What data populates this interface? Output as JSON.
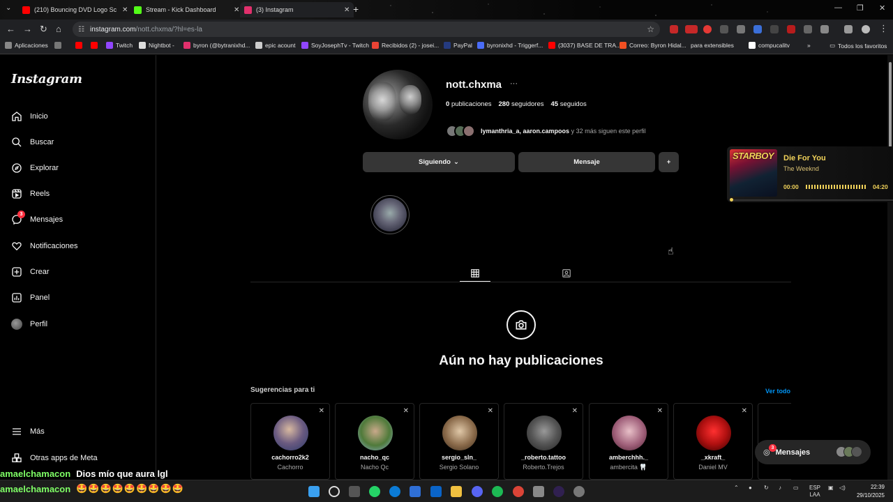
{
  "browser": {
    "tabs": [
      {
        "title": "(210) Bouncing DVD Logo Scre",
        "favicon_color": "#ff0000"
      },
      {
        "title": "Stream - Kick Dashboard",
        "favicon_color": "#53fc18"
      },
      {
        "title": "(3) Instagram",
        "favicon_color": "#e1306c"
      }
    ],
    "new_tab": "+",
    "url_host": "instagram.com",
    "url_path": "/nott.chxma/?hl=es-la",
    "bookmarks": [
      {
        "label": "Aplicaciones",
        "color": "#888888"
      },
      {
        "label": "",
        "color": "#ff0000"
      },
      {
        "label": "",
        "color": "#ff0000"
      },
      {
        "label": "Twitch",
        "color": "#9146ff"
      },
      {
        "label": "Nightbot -",
        "color": "#dddddd"
      },
      {
        "label": "byron (@bytranixhd...",
        "color": "#e1306c"
      },
      {
        "label": "epic acount",
        "color": "#cccccc"
      },
      {
        "label": "SoyJosephTv - Twitch",
        "color": "#9146ff"
      },
      {
        "label": "Recibidos (2) - josei...",
        "color": "#ea4335"
      },
      {
        "label": "PayPal",
        "color": "#253b80"
      },
      {
        "label": "byronixhd - Triggerf...",
        "color": "#4a6cf7"
      },
      {
        "label": "(3037) BASE DE TRA...",
        "color": "#ff0000"
      },
      {
        "label": "Correo: Byron Hidal...",
        "color": "#f25022"
      },
      {
        "label": "para extensibles",
        "color": "#cccccc"
      },
      {
        "label": "compucalitv",
        "color": "#ffffff"
      }
    ],
    "all_favorites": "Todos los favoritos"
  },
  "sidebar": {
    "logo": "Instagram",
    "items": [
      {
        "label": "Inicio",
        "icon": "home-icon"
      },
      {
        "label": "Buscar",
        "icon": "search-icon"
      },
      {
        "label": "Explorar",
        "icon": "compass-icon"
      },
      {
        "label": "Reels",
        "icon": "reels-icon"
      },
      {
        "label": "Mensajes",
        "icon": "messenger-icon",
        "badge": "3"
      },
      {
        "label": "Notificaciones",
        "icon": "heart-icon"
      },
      {
        "label": "Crear",
        "icon": "plus-icon"
      },
      {
        "label": "Panel",
        "icon": "chart-icon"
      },
      {
        "label": "Perfil",
        "icon": "avatar"
      }
    ],
    "more": "Más",
    "meta_apps": "Otras apps de Meta"
  },
  "profile": {
    "username": "nott.chxma",
    "posts_count": "0",
    "posts_label": "publicaciones",
    "followers_count": "280",
    "followers_label": "seguidores",
    "following_count": "45",
    "following_label": "seguidos",
    "followed_by_names": "lymanthria_a, aaron.campoos",
    "followed_by_rest": "y 32 más siguen este perfil",
    "following_button": "Siguiendo",
    "message_button": "Mensaje",
    "empty_title": "Aún no hay publicaciones"
  },
  "suggestions": {
    "title": "Sugerencias para ti",
    "see_all": "Ver todo",
    "cards": [
      {
        "username": "cachorro2k2",
        "name": "Cachorro",
        "color": "#5a6fa0"
      },
      {
        "username": "nacho_qc",
        "name": "Nacho Qc",
        "color": "#4f7a3a"
      },
      {
        "username": "sergio_sln_",
        "name": "Sergio Solano",
        "color": "#8a6a4a"
      },
      {
        "username": "_roberto.tattoo",
        "name": "Roberto.Trejos",
        "color": "#555555"
      },
      {
        "username": "amberchhh._",
        "name": "ambercita 🦷",
        "color": "#a0607a"
      },
      {
        "username": "_xkraft_",
        "name": "Daniel MV",
        "color": "#b01010"
      }
    ]
  },
  "messages_pill": {
    "label": "Mensajes",
    "badge": "3"
  },
  "music": {
    "cover_text": "STARBOY",
    "song": "Die For You",
    "artist": "The Weeknd",
    "time_current": "00:00",
    "time_total": "04:20",
    "progress": 0.0
  },
  "chat_overlay": {
    "line1_user": "amaelchamacon",
    "line1_text": "Dios mío que aura lgl",
    "line2_user": "amaelchamacon",
    "line2_text": "🤩🤩🤩🤩🤩🤩🤩🤩🤩"
  },
  "taskbar": {
    "lang_top": "ESP",
    "lang_bottom": "LAA",
    "time": "22:39",
    "date": "29/10/2025"
  },
  "colors": {
    "accent_blue": "#0095f6",
    "badge_red": "#ff3040",
    "music_yellow": "#f2d35a"
  }
}
